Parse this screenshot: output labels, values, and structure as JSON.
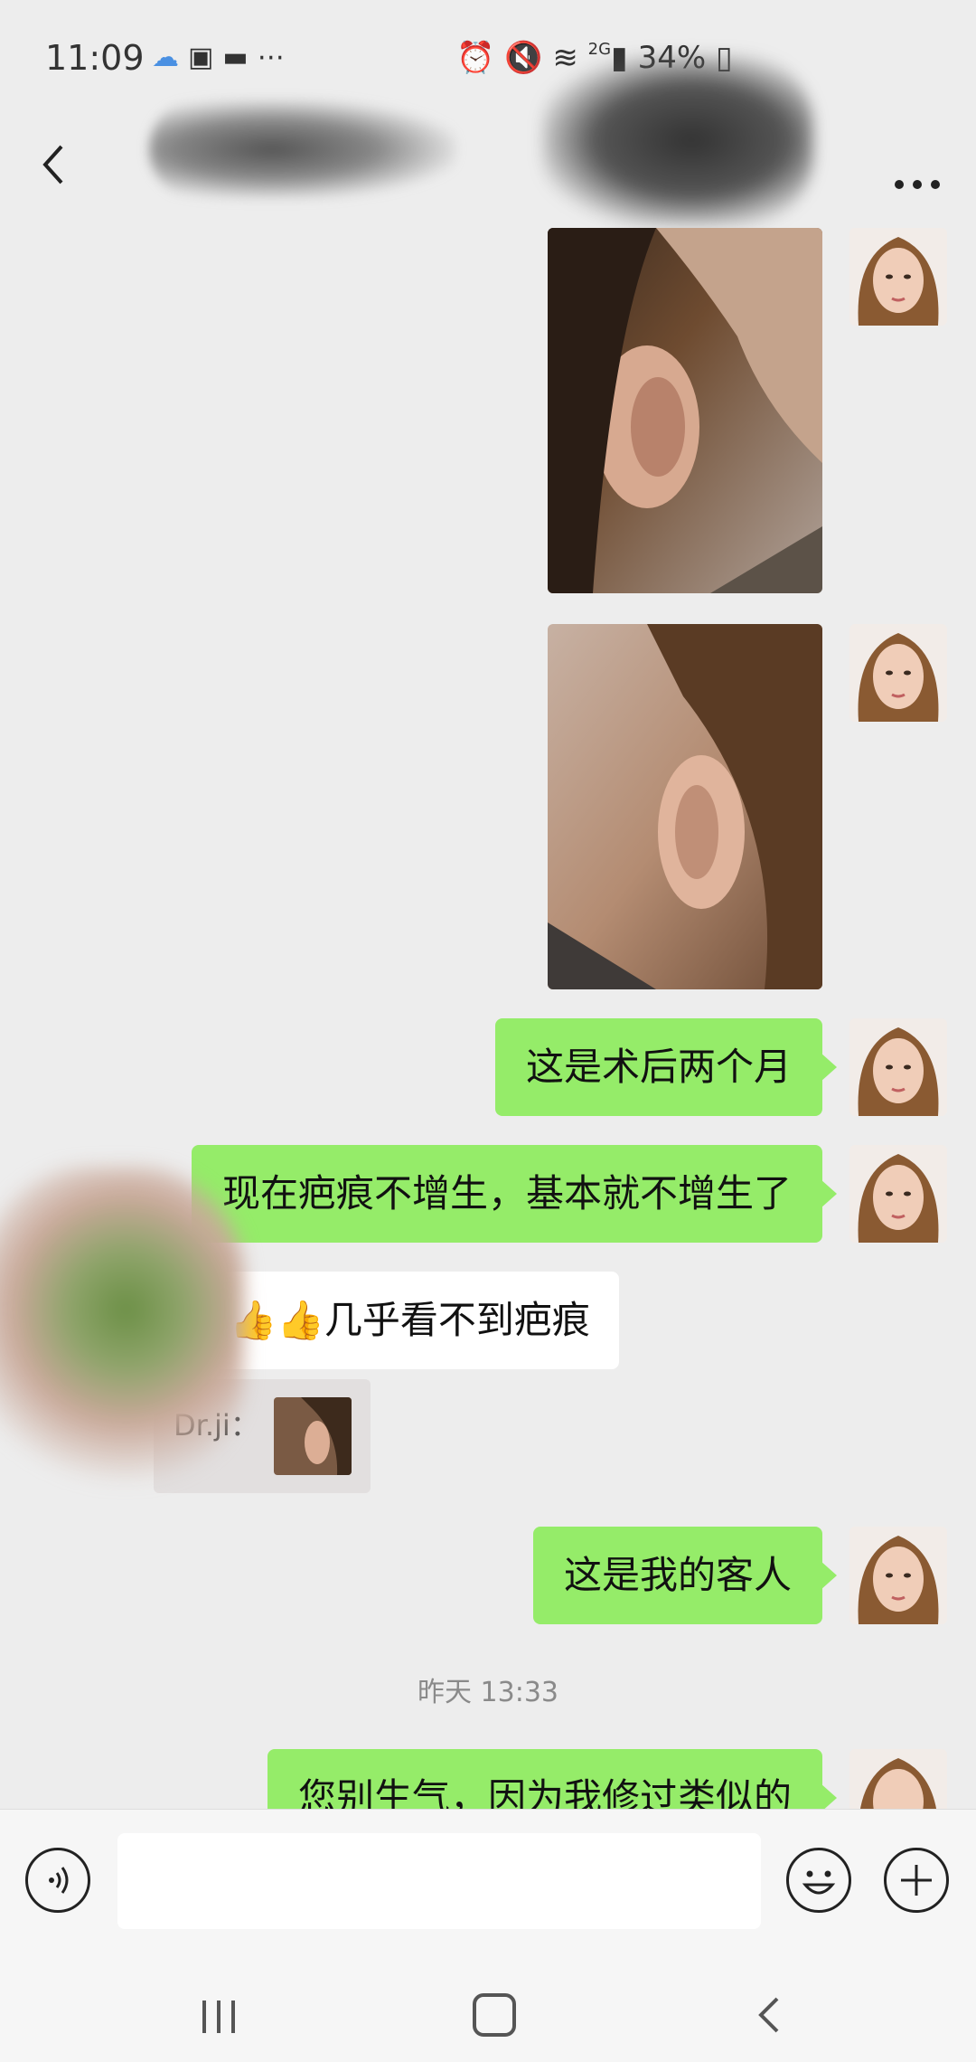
{
  "status_bar": {
    "time": "11:09",
    "left_icons": [
      "cloud-icon",
      "image-icon",
      "message-icon",
      "more-dots"
    ],
    "network": "2G",
    "battery": "34%"
  },
  "header": {
    "back_icon": "chevron-left-icon",
    "more_icon": "more-horizontal-icon"
  },
  "messages": [
    {
      "side": "me",
      "type": "image",
      "desc": "ear-photo-1"
    },
    {
      "side": "me",
      "type": "image",
      "desc": "ear-photo-2"
    },
    {
      "side": "me",
      "type": "text",
      "text": "这是术后两个月"
    },
    {
      "side": "me",
      "type": "text",
      "text": "现在疤痕不增生，基本就不增生了"
    },
    {
      "side": "other",
      "type": "text",
      "text": "👍👍👍几乎看不到疤痕"
    },
    {
      "side": "other",
      "type": "quote",
      "name": "Dr.ji："
    },
    {
      "side": "me",
      "type": "text",
      "text": "这是我的客人"
    },
    {
      "side": "me",
      "type": "text",
      "text": "您别生气，因为我修过类似的"
    }
  ],
  "timestamp": "昨天 13:33",
  "input": {
    "placeholder": ""
  },
  "colors": {
    "my_bubble": "#95ec69",
    "background": "#ededed",
    "other_bubble": "#ffffff"
  }
}
